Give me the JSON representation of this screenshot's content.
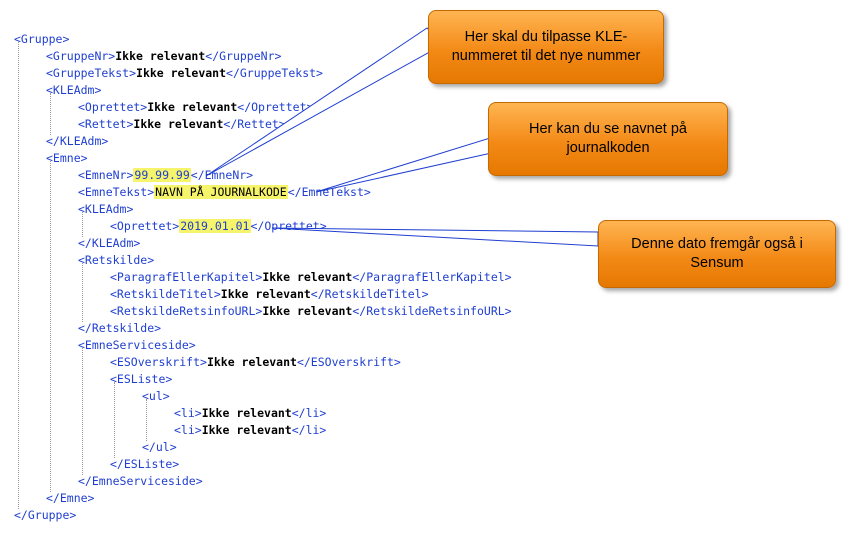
{
  "xml": {
    "l1_open": "<Gruppe>",
    "l2_open": "<GruppeNr>",
    "l2_val": "Ikke relevant",
    "l2_close": "</GruppeNr>",
    "l3_open": "<GruppeTekst>",
    "l3_val": "Ikke relevant",
    "l3_close": "</GruppeTekst>",
    "l4_open": "<KLEAdm>",
    "l5_open": "<Oprettet>",
    "l5_val": "Ikke relevant",
    "l5_close": "</Oprettet>",
    "l6_open": "<Rettet>",
    "l6_val": "Ikke relevant",
    "l6_close": "</Rettet>",
    "l7_close": "</KLEAdm>",
    "l8_open": "<Emne>",
    "l9_open": "<EmneNr>",
    "l9_val": "99.99.99",
    "l9_close": "</EmneNr>",
    "l10_open": "<EmneTekst>",
    "l10_val": "NAVN PÅ JOURNALKODE",
    "l10_close": "</EmneTekst>",
    "l11_open": "<KLEAdm>",
    "l12_open": "<Oprettet>",
    "l12_val": "2019.01.01",
    "l12_close": "</Oprettet>",
    "l13_close": "</KLEAdm>",
    "l14_open": "<Retskilde>",
    "l15_open": "<ParagrafEllerKapitel>",
    "l15_val": "Ikke relevant",
    "l15_close": "</ParagrafEllerKapitel>",
    "l16_open": "<RetskildeTitel>",
    "l16_val": "Ikke relevant",
    "l16_close": "</RetskildeTitel>",
    "l17_open": "<RetskildeRetsinfoURL>",
    "l17_val": "Ikke relevant",
    "l17_close": "</RetskildeRetsinfoURL>",
    "l18_close": "</Retskilde>",
    "l19_open": "<EmneServiceside>",
    "l20_open": "<ESOverskrift>",
    "l20_val": "Ikke relevant",
    "l20_close": "</ESOverskrift>",
    "l21_open": "<ESListe>",
    "l22_open": "<ul>",
    "l23_open": "<li>",
    "l23_val": "Ikke relevant",
    "l23_close": "</li>",
    "l24_open": "<li>",
    "l24_val": "Ikke relevant",
    "l24_close": "</li>",
    "l25_close": "</ul>",
    "l26_close": "</ESListe>",
    "l27_close": "</EmneServiceside>",
    "l28_close": "</Emne>",
    "l29_close": "</Gruppe>"
  },
  "callouts": {
    "kle_number": "Her skal du tilpasse KLE-nummeret til det nye nummer",
    "journal_name": "Her kan du se navnet på journalkoden",
    "date": "Denne dato fremgår også i Sensum"
  },
  "colors": {
    "tag": "#1f3fd0",
    "highlight": "#f6f46a",
    "callout_fill": "#f38a17",
    "leader_line": "#1f3fd0"
  }
}
